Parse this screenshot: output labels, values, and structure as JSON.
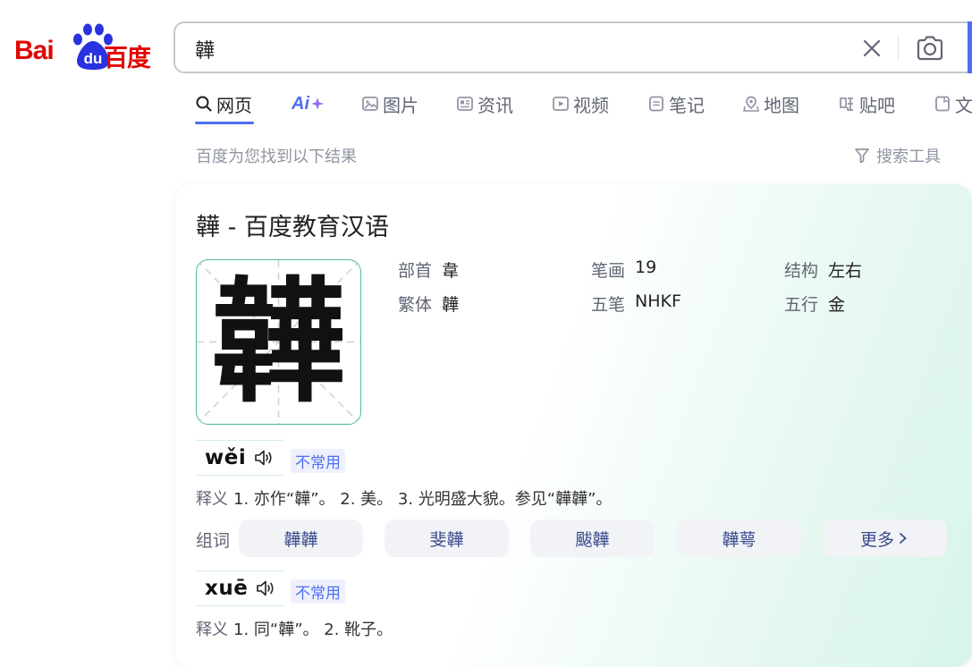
{
  "logo": {
    "latin": "Bai",
    "du": "du",
    "chinese": "百度"
  },
  "search": {
    "query": "韡"
  },
  "tabs": [
    {
      "label": "网页",
      "icon": "search-icon",
      "active": true
    },
    {
      "label": "Ai",
      "icon": "ai-sparkle-icon"
    },
    {
      "label": "图片",
      "icon": "image-icon"
    },
    {
      "label": "资讯",
      "icon": "news-icon"
    },
    {
      "label": "视频",
      "icon": "video-icon"
    },
    {
      "label": "笔记",
      "icon": "note-icon"
    },
    {
      "label": "地图",
      "icon": "map-icon"
    },
    {
      "label": "贴吧",
      "icon": "tieba-icon"
    },
    {
      "label": "文",
      "icon": "doc-icon"
    }
  ],
  "result_hint": "百度为您找到以下结果",
  "search_tools": "搜索工具",
  "card": {
    "title": "韡 - 百度教育汉语",
    "character": "韡",
    "info": {
      "radical_label": "部首",
      "radical_value": "韋",
      "strokes_label": "笔画",
      "strokes_value": "19",
      "structure_label": "结构",
      "structure_value": "左右",
      "traditional_label": "繁体",
      "traditional_value": "韡",
      "wubi_label": "五笔",
      "wubi_value": "NHKF",
      "wuxing_label": "五行",
      "wuxing_value": "金"
    },
    "readings": [
      {
        "pinyin": "wěi",
        "badge": "不常用",
        "def_label": "释义",
        "definition": "1. 亦作“韡”。 2. 美。 3. 光明盛大貌。参见“韡韡”。"
      },
      {
        "pinyin": "xuē",
        "badge": "不常用",
        "def_label": "释义",
        "definition": "1. 同“韡”。 2. 靴子。"
      }
    ],
    "words_label": "组词",
    "words": [
      "韡韡",
      "斐韡",
      "颰韡",
      "韡萼"
    ],
    "more_label": "更多"
  },
  "colors": {
    "accent": "#4e6ef2",
    "brand_red": "#e10602",
    "brand_blue": "#2932e1",
    "teal": "#4fb8a2"
  }
}
